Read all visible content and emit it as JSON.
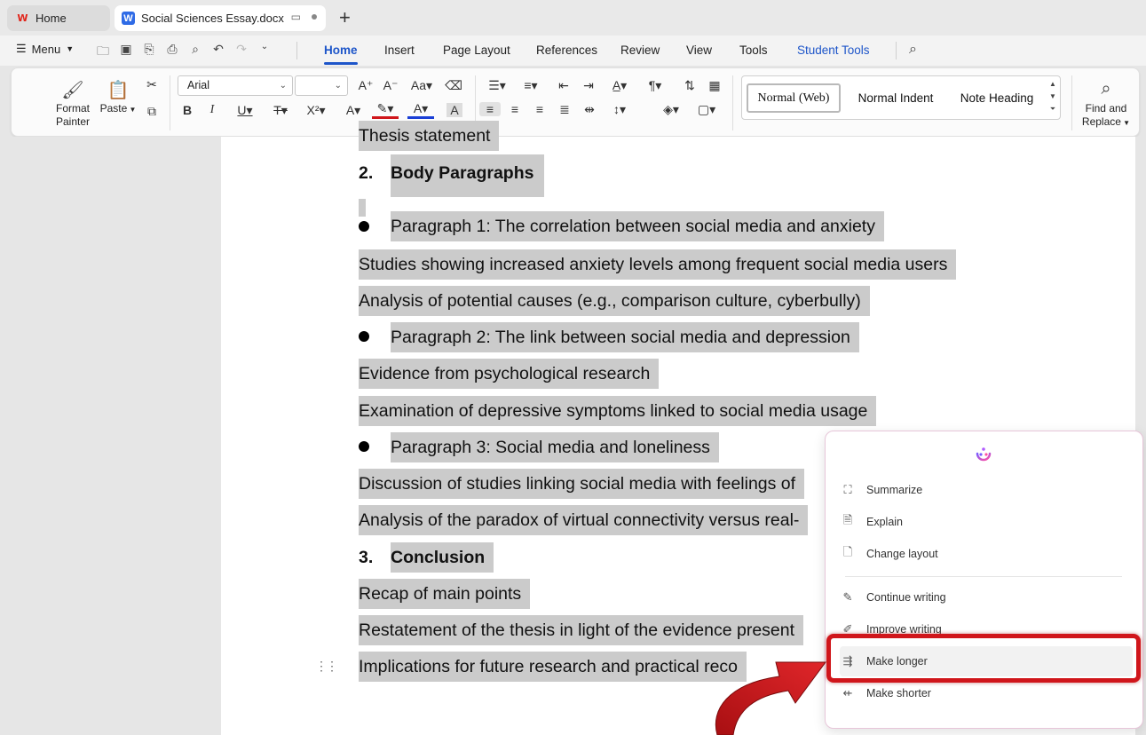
{
  "tabs": {
    "home_label": "Home",
    "doc_label": "Social Sciences Essay.docx"
  },
  "menu": {
    "menu_label": "Menu",
    "tabs": [
      "Home",
      "Insert",
      "Page Layout",
      "References",
      "Review",
      "View",
      "Tools",
      "Student Tools"
    ]
  },
  "ribbon": {
    "format_painter": "Format Painter",
    "format_painter_l1": "Format",
    "format_painter_l2": "Painter",
    "paste": "Paste",
    "font_name": "Arial",
    "font_size": "",
    "styles": [
      "Normal (Web)",
      "Normal Indent",
      "Note Heading"
    ],
    "find_replace_l1": "Find and",
    "find_replace_l2": "Replace"
  },
  "document": {
    "line_top": "Thesis statement",
    "heading2_num": "2.",
    "heading2": "Body Paragraphs",
    "p1": "Paragraph 1: The correlation between social media and anxiety",
    "p1a": "Studies showing increased anxiety levels among frequent social media users",
    "p1b": "Analysis of potential causes (e.g., comparison culture, cyberbully)",
    "p2": "Paragraph 2: The link between social media and depression",
    "p2a": "Evidence from psychological research",
    "p2b": "Examination of depressive symptoms linked to social media usage",
    "p3": "Paragraph 3: Social media and loneliness",
    "p3a": "Discussion of studies linking social media with feelings of",
    "p3b": "Analysis of the paradox of virtual connectivity versus real-",
    "heading3_num": "3.",
    "heading3": "Conclusion",
    "c1": "Recap of main points",
    "c2": "Restatement of the thesis in light of the evidence present",
    "c3": "Implications for future research and practical reco"
  },
  "ai_menu": {
    "items": [
      "Summarize",
      "Explain",
      "Change layout",
      "Continue writing",
      "Improve writing",
      "Make longer",
      "Make shorter"
    ],
    "highlighted": "Make longer"
  },
  "colors": {
    "accent": "#1d55c9",
    "selection": "#cbcbcb",
    "annotation_red": "#d0161b"
  }
}
